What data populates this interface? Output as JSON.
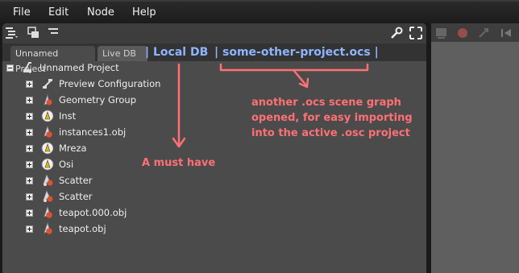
{
  "menu": {
    "file": "File",
    "edit": "Edit",
    "node": "Node",
    "help": "Help"
  },
  "tabs": {
    "active": "Unnamed Project",
    "inactive": "Live DB"
  },
  "annotations": {
    "local_db": "| Local DB",
    "other_project": "| some-other-project.ocs |",
    "note_lines": [
      "another .ocs scene graph",
      "opened, for easy importing",
      "into the active .osc project"
    ],
    "must_have": "A must have"
  },
  "tree": {
    "root": {
      "label": "Unnamed Project",
      "icon": "project-icon"
    },
    "items": [
      {
        "label": "Preview Configuration",
        "icon": "config-icon"
      },
      {
        "label": "Geometry Group",
        "icon": "geometry-group-icon"
      },
      {
        "label": "Inst",
        "icon": "instance-icon"
      },
      {
        "label": "instances1.obj",
        "icon": "mesh-icon"
      },
      {
        "label": "Mreza",
        "icon": "instance-icon"
      },
      {
        "label": "Osi",
        "icon": "instance-icon"
      },
      {
        "label": "Scatter",
        "icon": "scatter-icon"
      },
      {
        "label": "Scatter",
        "icon": "scatter-icon"
      },
      {
        "label": "teapot.000.obj",
        "icon": "mesh-icon"
      },
      {
        "label": "teapot.obj",
        "icon": "mesh-icon"
      }
    ]
  },
  "colors": {
    "annotation_red": "#ff7074",
    "annotation_blue": "#8fb4ff",
    "panel_bg": "#4b4b4b"
  }
}
